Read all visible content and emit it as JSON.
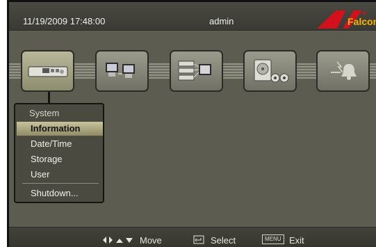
{
  "topbar": {
    "datetime": "11/19/2009  17:48:00",
    "user": "admin",
    "logo_text": "Falcon"
  },
  "icons": [
    {
      "name": "system",
      "active": true
    },
    {
      "name": "network",
      "active": false
    },
    {
      "name": "storage",
      "active": false
    },
    {
      "name": "record",
      "active": false
    },
    {
      "name": "alarm",
      "active": false
    }
  ],
  "menu": {
    "title": "System",
    "items": [
      "Information",
      "Date/Time",
      "Storage",
      "User",
      "Shutdown..."
    ],
    "selected": "Information"
  },
  "bottombar": {
    "move_label": "Move",
    "select_label": "Select",
    "exit_label": "Exit",
    "menu_key": "MENU"
  },
  "colors": {
    "accent": "#f6b400",
    "background": "#5d5c50"
  }
}
